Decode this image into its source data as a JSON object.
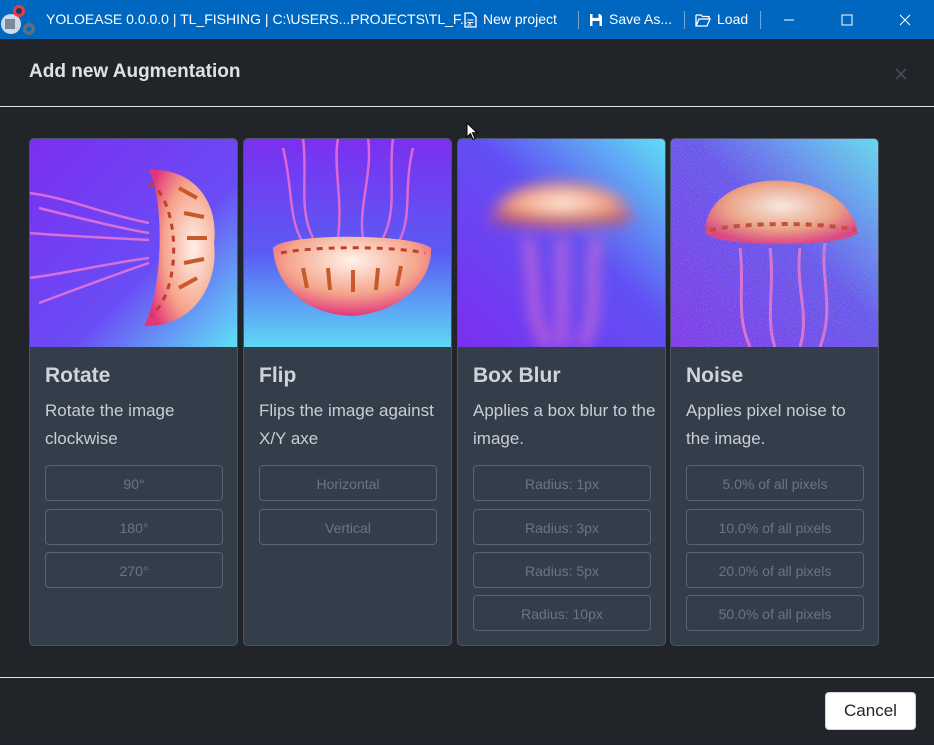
{
  "window": {
    "title": "YOLOEASE 0.0.0.0 | TL_FISHING | C:\\USERS...PROJECTS\\TL_F...",
    "new_project_label": "New project",
    "save_as_label": "Save As...",
    "load_label": "Load",
    "colors": {
      "titlebar": "#0067c0"
    }
  },
  "modal": {
    "title": "Add new Augmentation",
    "cancel_label": "Cancel"
  },
  "cards": [
    {
      "title": "Rotate",
      "description": "Rotate the image clockwise",
      "options": [
        "90°",
        "180°",
        "270°"
      ]
    },
    {
      "title": "Flip",
      "description": "Flips the image against X/Y axe",
      "options": [
        "Horizontal",
        "Vertical"
      ]
    },
    {
      "title": "Box Blur",
      "description": "Applies a box blur to the image.",
      "options": [
        "Radius: 1px",
        "Radius: 3px",
        "Radius: 5px",
        "Radius: 10px"
      ]
    },
    {
      "title": "Noise",
      "description": "Applies pixel noise to the image.",
      "options": [
        "5.0% of all pixels",
        "10.0% of all pixels",
        "20.0% of all pixels",
        "50.0% of all pixels"
      ]
    }
  ]
}
